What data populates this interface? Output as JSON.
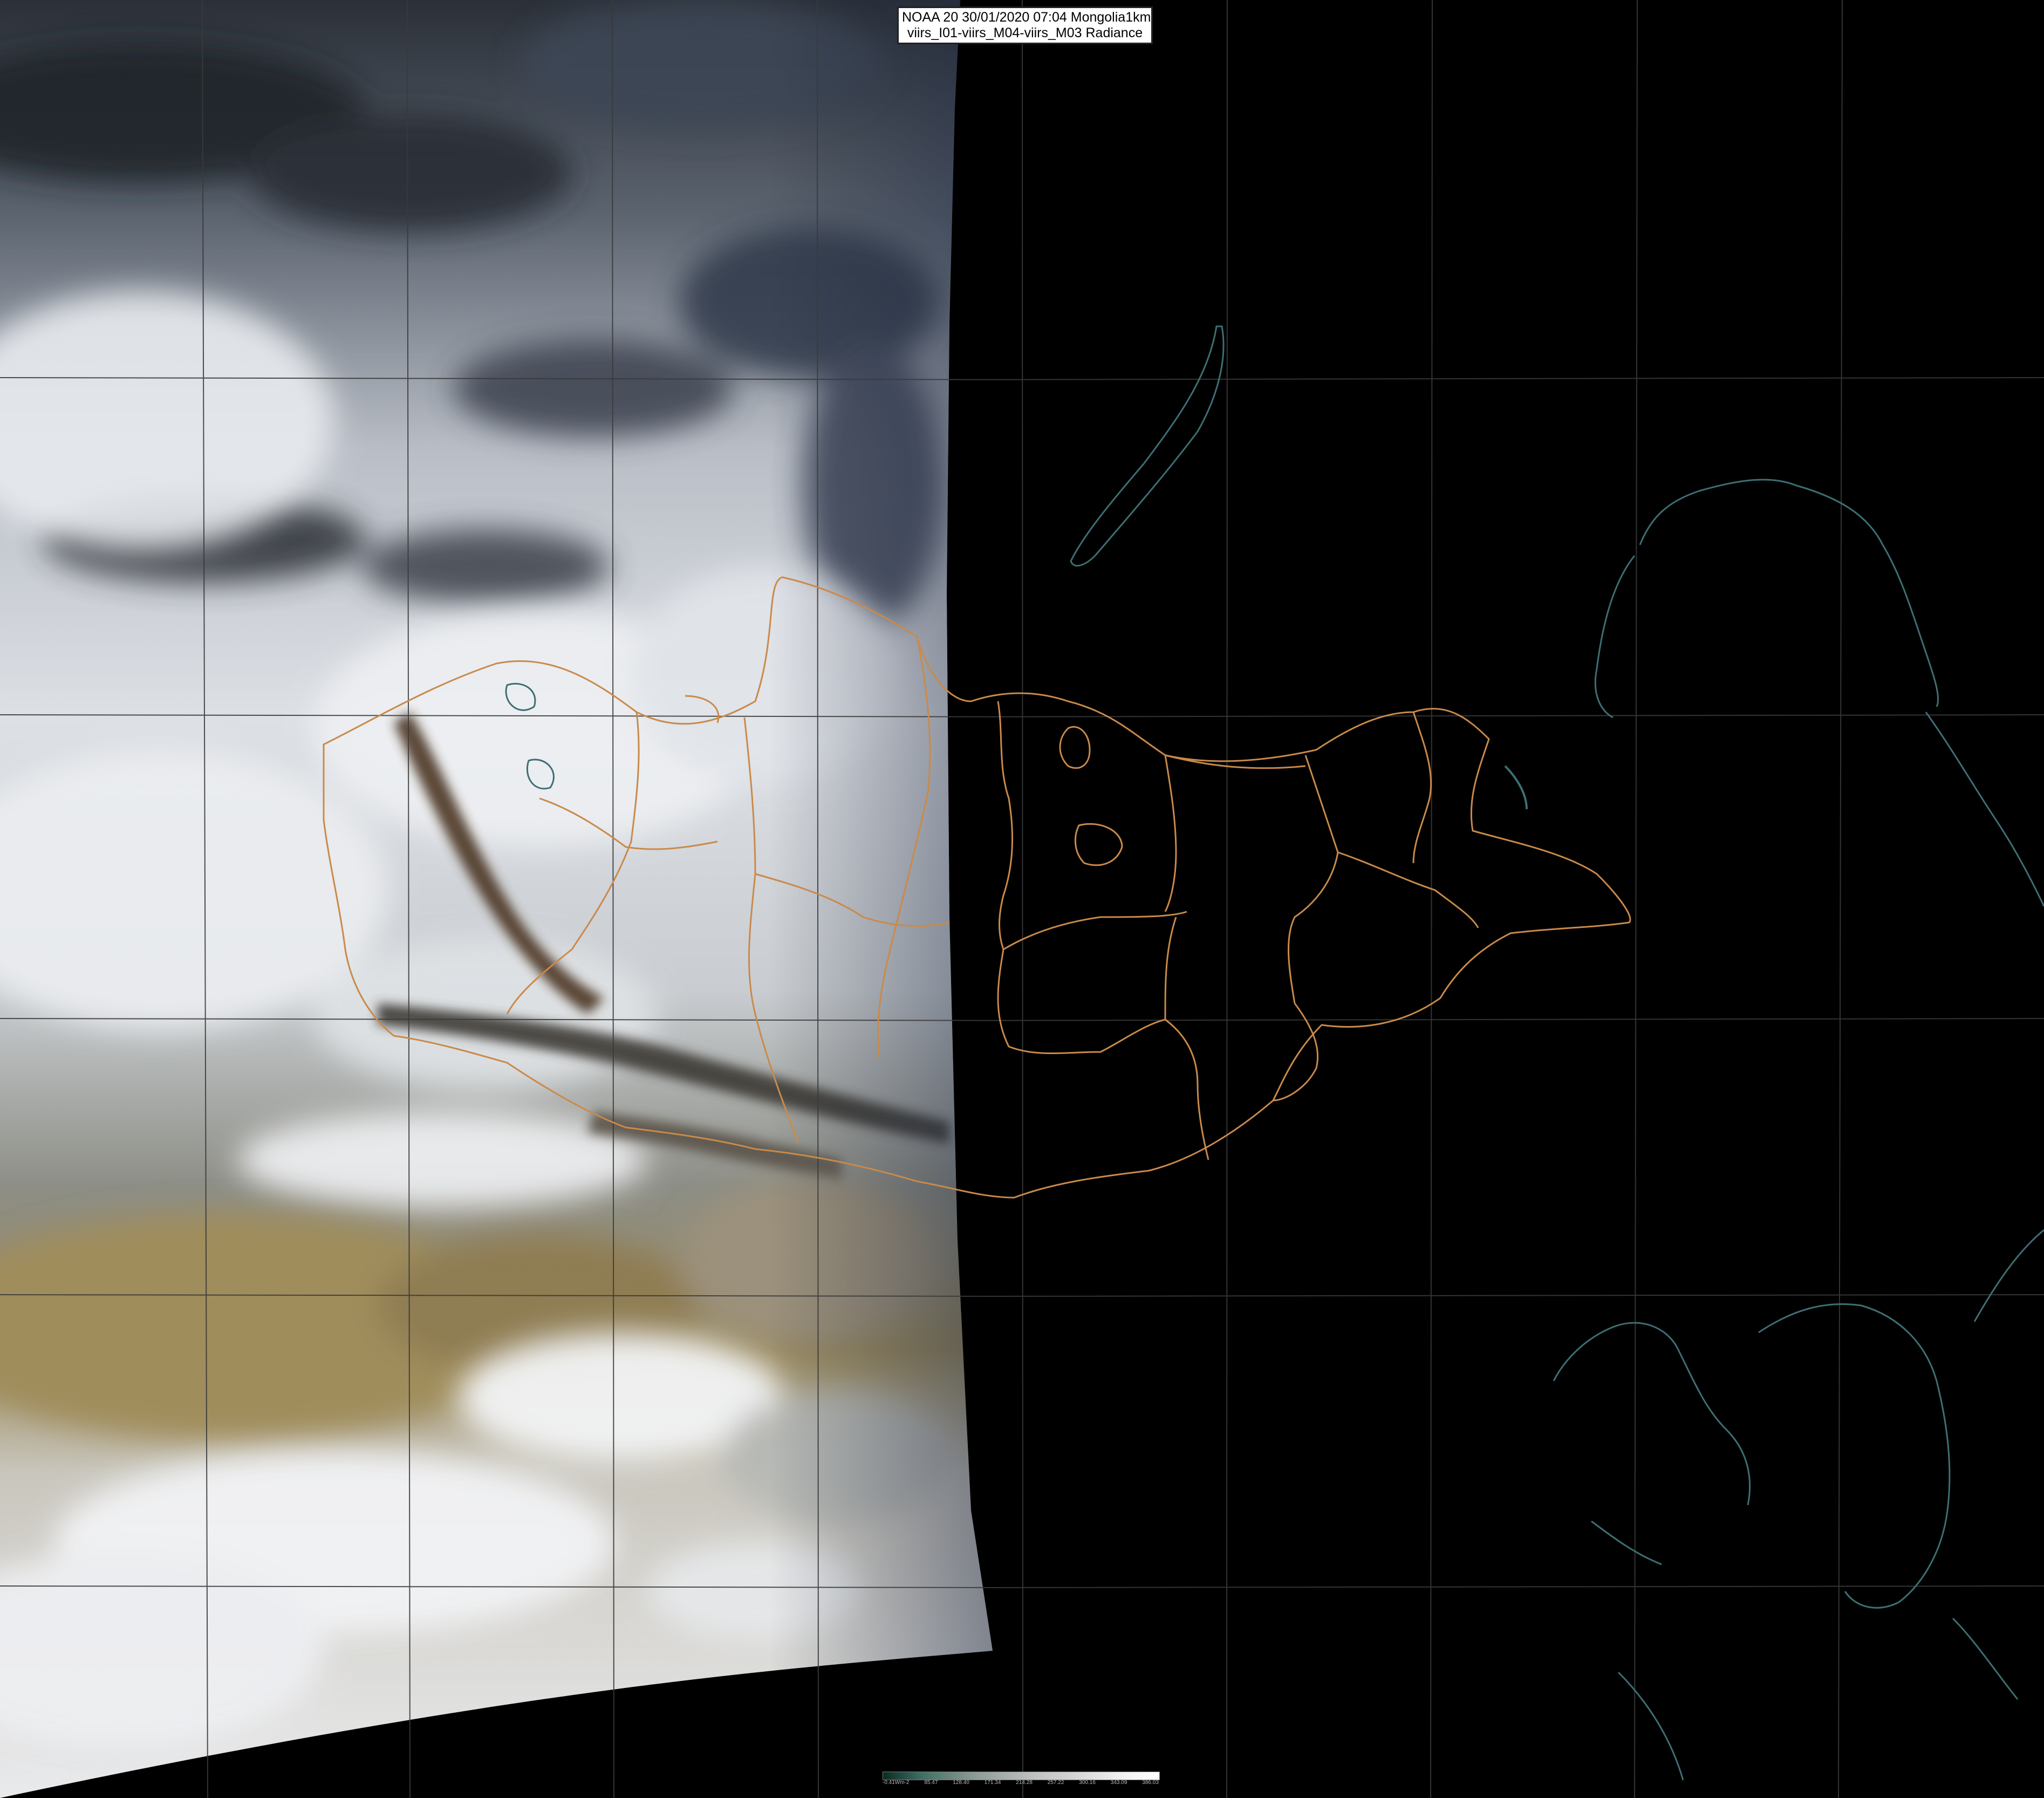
{
  "title": {
    "line1": "NOAA 20 30/01/2020 07:04 Mongolia1km",
    "line2": "viirs_I01-viirs_M04-viirs_M03 Radiance"
  },
  "colorbar": {
    "ticks": [
      "-0.41Wm-2",
      "85.47",
      "128.40",
      "171.34",
      "214.28",
      "257.22",
      "300.16",
      "343.09",
      "386.03"
    ]
  },
  "colors": {
    "background": "#000000",
    "grid": "#3a3a3a",
    "admin_border": "#c98a4a",
    "coastline": "#3d6f74",
    "snow": "#eceff2",
    "desert": "#a08d5c"
  }
}
